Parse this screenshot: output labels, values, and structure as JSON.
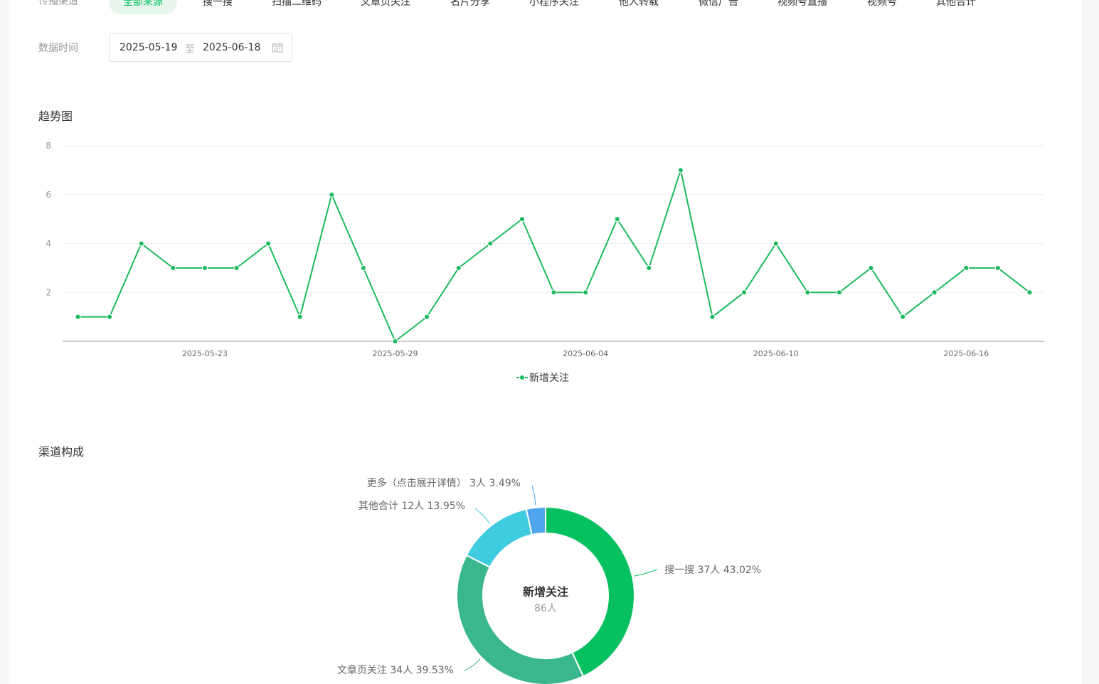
{
  "filters": {
    "channel_label": "传播渠道",
    "channels": [
      "全部来源",
      "搜一搜",
      "扫描二维码",
      "文章页关注",
      "名片分享",
      "小程序关注",
      "他人转载",
      "微信广告",
      "视频号直播",
      "视频号",
      "其他合计"
    ],
    "active_channel": "全部来源",
    "date_label": "数据时间",
    "date_start": "2025-05-19",
    "date_sep": "至",
    "date_end": "2025-06-18"
  },
  "trend": {
    "title": "趋势图",
    "legend": "新增关注"
  },
  "composition": {
    "title": "渠道构成",
    "center_title": "新增关注",
    "center_value": "86人"
  },
  "colors": {
    "accent": "#07c160",
    "line": "#1aba5c",
    "slice_search": "#07c160",
    "slice_article": "#3bb78f",
    "slice_other": "#40cce0",
    "slice_more": "#4fa6ec",
    "text": "#353535",
    "muted": "#9a9a9a"
  },
  "chart_data": [
    {
      "type": "line",
      "x": [
        "2025-05-19",
        "2025-05-20",
        "2025-05-21",
        "2025-05-22",
        "2025-05-23",
        "2025-05-24",
        "2025-05-25",
        "2025-05-26",
        "2025-05-27",
        "2025-05-28",
        "2025-05-29",
        "2025-05-30",
        "2025-05-31",
        "2025-06-01",
        "2025-06-02",
        "2025-06-03",
        "2025-06-04",
        "2025-06-05",
        "2025-06-06",
        "2025-06-07",
        "2025-06-08",
        "2025-06-09",
        "2025-06-10",
        "2025-06-11",
        "2025-06-12",
        "2025-06-13",
        "2025-06-14",
        "2025-06-15",
        "2025-06-16",
        "2025-06-17",
        "2025-06-18"
      ],
      "series": [
        {
          "name": "新增关注",
          "values": [
            1,
            1,
            4,
            3,
            3,
            3,
            4,
            1,
            6,
            3,
            0,
            1,
            3,
            4,
            5,
            2,
            2,
            5,
            3,
            7,
            1,
            2,
            4,
            2,
            2,
            3,
            1,
            2,
            3,
            3,
            2
          ]
        }
      ],
      "x_ticks": [
        "2025-05-23",
        "2025-05-29",
        "2025-06-04",
        "2025-06-10",
        "2025-06-16"
      ],
      "y_ticks": [
        2,
        4,
        6,
        8
      ],
      "ylim": [
        0,
        8
      ],
      "grid": true,
      "legend": "bottom-center"
    },
    {
      "type": "pie",
      "categories": [
        "搜一搜",
        "文章页关注",
        "其他合计",
        "更多（点击展开详情）"
      ],
      "values": [
        37,
        34,
        12,
        3
      ],
      "labels": [
        "搜一搜 37人 43.02%",
        "文章页关注 34人 39.53%",
        "其他合计 12人 13.95%",
        "更多（点击展开详情） 3人 3.49%"
      ],
      "total": 86,
      "donut": true
    }
  ]
}
